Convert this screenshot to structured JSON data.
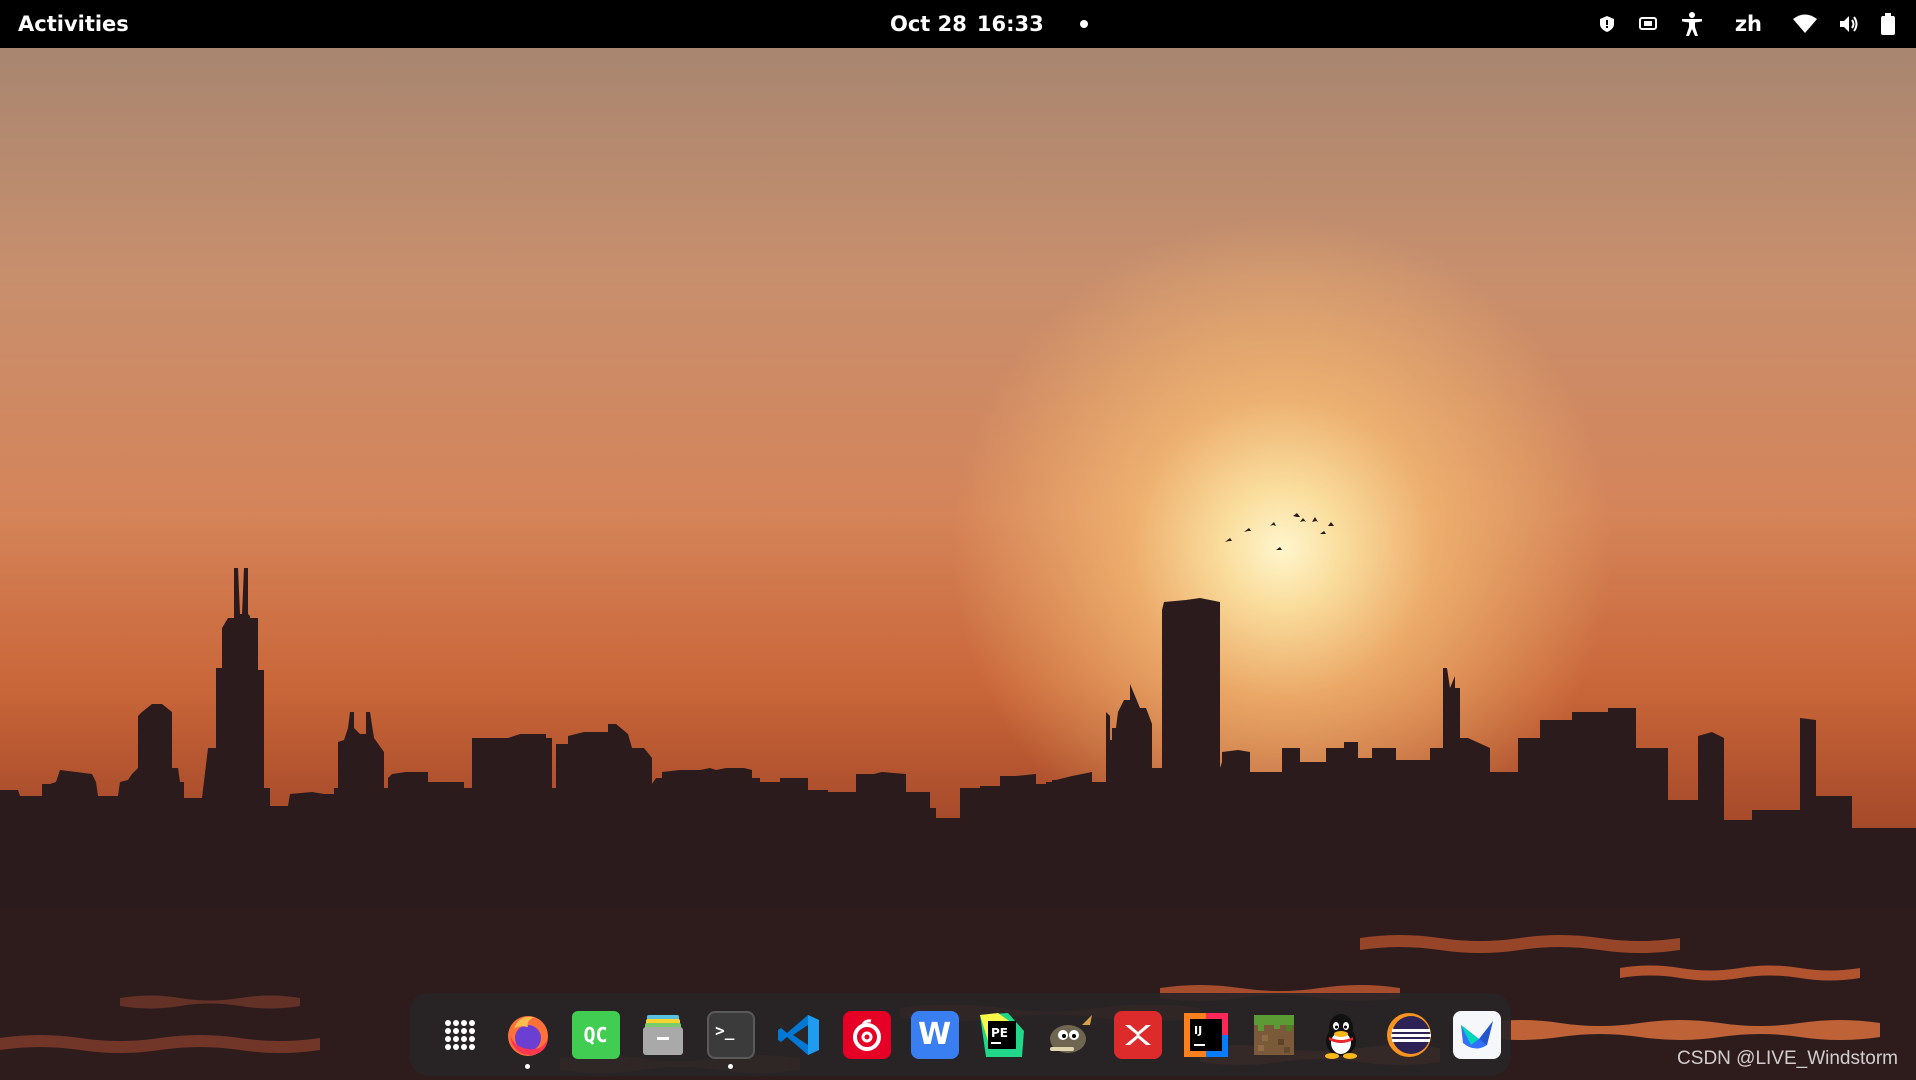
{
  "topbar": {
    "activities": "Activities",
    "date": "Oct 28",
    "time": "16:33",
    "language": "zh",
    "tray_icons": [
      "shield-icon",
      "screen-share-icon",
      "accessibility-icon",
      "wifi-icon",
      "volume-icon",
      "battery-icon"
    ]
  },
  "dock": {
    "items": [
      {
        "name": "app-grid",
        "icon": "grid-icon",
        "running": false
      },
      {
        "name": "firefox",
        "icon": "firefox-icon",
        "label": "",
        "running": true
      },
      {
        "name": "qt-creator",
        "icon": "qt-creator-icon",
        "label": "QC",
        "running": false
      },
      {
        "name": "files",
        "icon": "files-icon",
        "running": false
      },
      {
        "name": "terminal",
        "icon": "terminal-icon",
        "label": ">_",
        "running": true
      },
      {
        "name": "vscode",
        "icon": "vscode-icon",
        "running": false
      },
      {
        "name": "netease-music",
        "icon": "netease-music-icon",
        "running": false
      },
      {
        "name": "wps",
        "icon": "wps-icon",
        "label": "W",
        "running": false
      },
      {
        "name": "pycharm",
        "icon": "pycharm-icon",
        "label": "PE",
        "running": false
      },
      {
        "name": "gimp",
        "icon": "gimp-icon",
        "running": false
      },
      {
        "name": "xmind",
        "icon": "xmind-icon",
        "running": false
      },
      {
        "name": "intellij",
        "icon": "intellij-icon",
        "label": "IJ",
        "running": false
      },
      {
        "name": "minecraft",
        "icon": "minecraft-icon",
        "running": false
      },
      {
        "name": "qq",
        "icon": "qq-icon",
        "running": false
      },
      {
        "name": "eclipse",
        "icon": "eclipse-icon",
        "running": false
      },
      {
        "name": "feishu",
        "icon": "feishu-icon",
        "running": false
      }
    ]
  },
  "watermark": "CSDN @LIVE_Windstorm",
  "colors": {
    "topbar": "#000000",
    "dock": "#282426",
    "sky_top": "#a88670",
    "sky_mid": "#d58459",
    "sun": "#fff6cd",
    "skyline": "#2a1a1c"
  }
}
